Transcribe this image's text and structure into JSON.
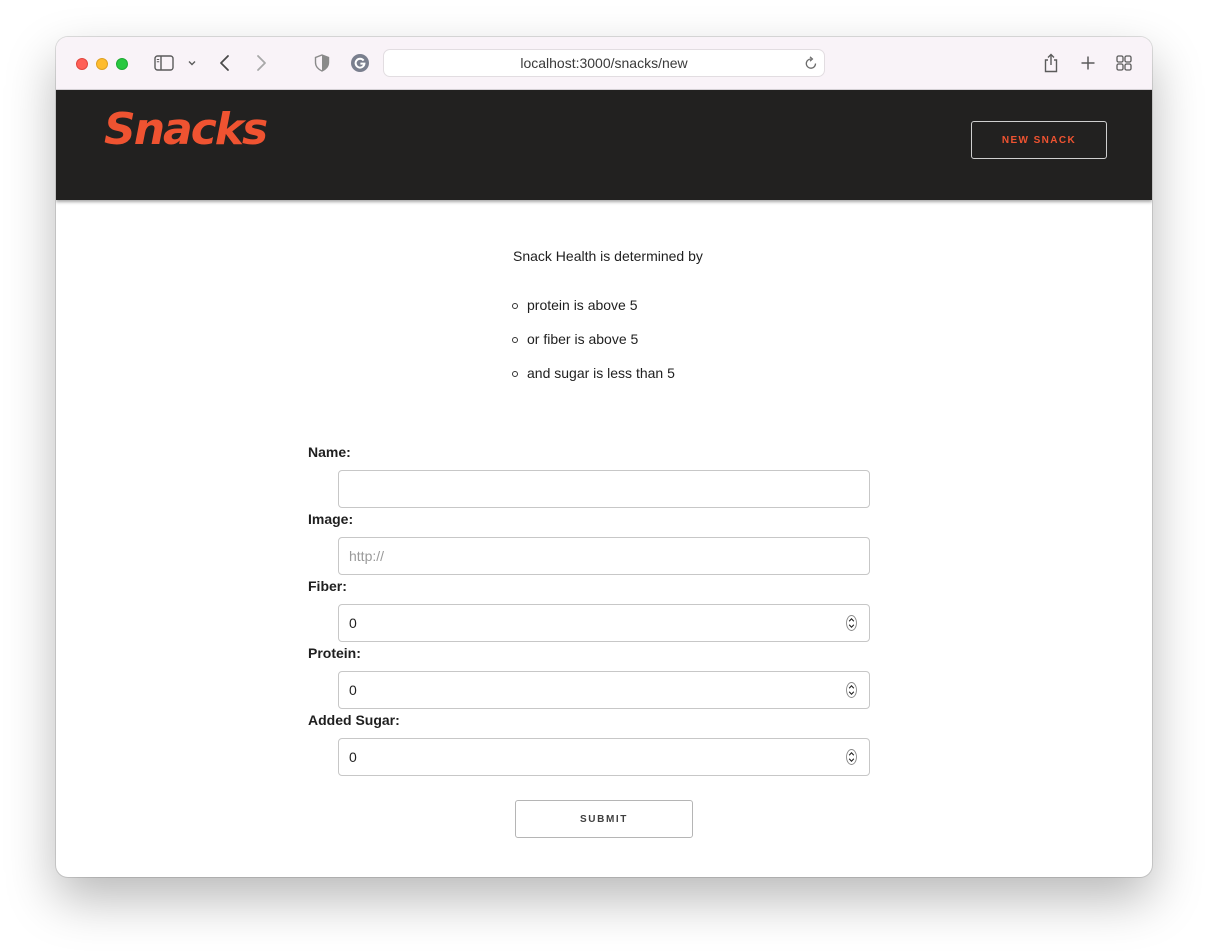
{
  "browser": {
    "url": "localhost:3000/snacks/new"
  },
  "header": {
    "logo_text": "Snacks",
    "new_snack_label": "NEW SNACK"
  },
  "info": {
    "intro": "Snack Health is determined by",
    "rules": [
      "protein is above 5",
      "or fiber is above 5",
      "and sugar is less than 5"
    ]
  },
  "form": {
    "name": {
      "label": "Name:",
      "value": ""
    },
    "image": {
      "label": "Image:",
      "placeholder": "http://"
    },
    "fiber": {
      "label": "Fiber:",
      "value": "0"
    },
    "protein": {
      "label": "Protein:",
      "value": "0"
    },
    "added_sugar": {
      "label": "Added Sugar:",
      "value": "0"
    },
    "submit_label": "SUBMIT"
  },
  "colors": {
    "brand": "#ef5331",
    "header_bg": "#222120"
  },
  "icons": [
    "sidebar-icon",
    "chevron-down-icon",
    "back-icon",
    "forward-icon",
    "shield-icon",
    "extension-icon",
    "reload-icon",
    "share-icon",
    "new-tab-icon",
    "tab-overview-icon",
    "stepper-icon"
  ]
}
